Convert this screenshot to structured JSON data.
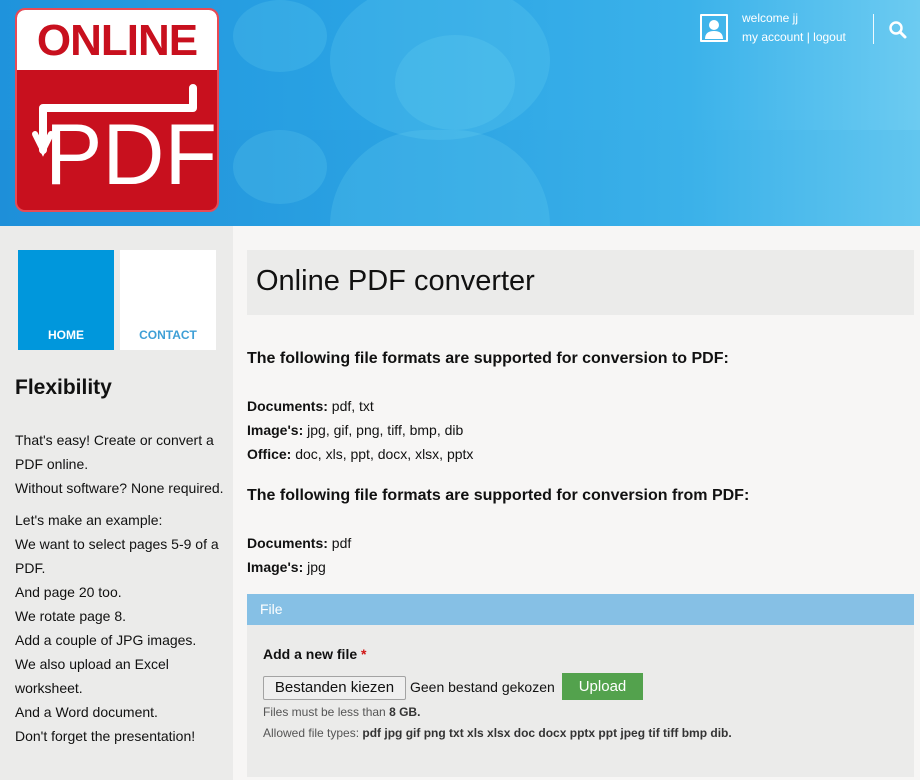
{
  "header": {
    "logo_top": "ONLINE",
    "logo_bottom": "PDF",
    "welcome": "welcome jj",
    "my_account": "my account",
    "separator": "|",
    "logout": "logout",
    "icons": {
      "user": "user-icon",
      "search": "search-icon"
    }
  },
  "nav": {
    "home": "HOME",
    "contact": "CONTACT"
  },
  "sidebar": {
    "title": "Flexibility",
    "paragraphs": [
      [
        "That's easy! Create or convert a PDF online.",
        "Without software? None required."
      ],
      [
        "Let's make an example:",
        "We want to select pages 5-9 of a PDF.",
        "And page 20 too.",
        "We rotate page 8.",
        "Add a couple of JPG images.",
        "We also upload an Excel worksheet.",
        "And a Word document.",
        "Don't forget the presentation!"
      ]
    ]
  },
  "main": {
    "title": "Online PDF converter",
    "to_pdf": {
      "heading": "The following file formats are supported for conversion to PDF:",
      "rows": [
        {
          "label": "Documents:",
          "value": "pdf, txt"
        },
        {
          "label": "Image's:",
          "value": "jpg, gif, png, tiff, bmp, dib"
        },
        {
          "label": "Office:",
          "value": "doc, xls, ppt, docx, xlsx, pptx"
        }
      ]
    },
    "from_pdf": {
      "heading": "The following file formats are supported for conversion from PDF:",
      "rows": [
        {
          "label": "Documents:",
          "value": "pdf"
        },
        {
          "label": "Image's:",
          "value": "jpg"
        }
      ]
    },
    "file_section": {
      "title": "File",
      "add_label": "Add a new file",
      "required_mark": "*",
      "choose_button": "Bestanden kiezen",
      "no_file": "Geen bestand gekozen",
      "upload_button": "Upload",
      "size_hint_prefix": "Files must be less than ",
      "size_hint_value": "8 GB.",
      "types_hint_prefix": "Allowed file types: ",
      "types_hint_value": "pdf jpg gif png txt xls xlsx doc docx pptx ppt jpeg tif tiff bmp dib."
    }
  },
  "colors": {
    "logo_red": "#c8101e",
    "nav_active": "#0097dc",
    "nav_link": "#3e9fd6",
    "file_bar": "#86c0e5",
    "upload_green": "#53a24d"
  }
}
